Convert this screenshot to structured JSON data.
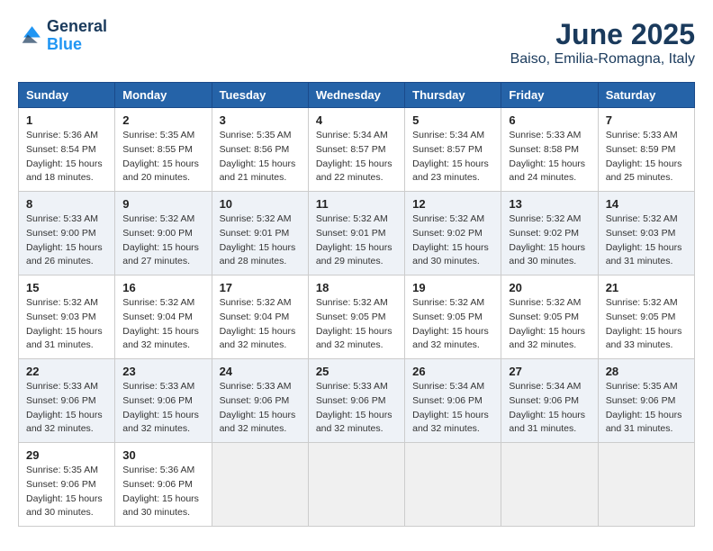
{
  "header": {
    "logo_line1": "General",
    "logo_line2": "Blue",
    "main_title": "June 2025",
    "subtitle": "Baiso, Emilia-Romagna, Italy"
  },
  "columns": [
    "Sunday",
    "Monday",
    "Tuesday",
    "Wednesday",
    "Thursday",
    "Friday",
    "Saturday"
  ],
  "weeks": [
    {
      "days": [
        {
          "num": "1",
          "info": "Sunrise: 5:36 AM\nSunset: 8:54 PM\nDaylight: 15 hours\nand 18 minutes."
        },
        {
          "num": "2",
          "info": "Sunrise: 5:35 AM\nSunset: 8:55 PM\nDaylight: 15 hours\nand 20 minutes."
        },
        {
          "num": "3",
          "info": "Sunrise: 5:35 AM\nSunset: 8:56 PM\nDaylight: 15 hours\nand 21 minutes."
        },
        {
          "num": "4",
          "info": "Sunrise: 5:34 AM\nSunset: 8:57 PM\nDaylight: 15 hours\nand 22 minutes."
        },
        {
          "num": "5",
          "info": "Sunrise: 5:34 AM\nSunset: 8:57 PM\nDaylight: 15 hours\nand 23 minutes."
        },
        {
          "num": "6",
          "info": "Sunrise: 5:33 AM\nSunset: 8:58 PM\nDaylight: 15 hours\nand 24 minutes."
        },
        {
          "num": "7",
          "info": "Sunrise: 5:33 AM\nSunset: 8:59 PM\nDaylight: 15 hours\nand 25 minutes."
        }
      ]
    },
    {
      "days": [
        {
          "num": "8",
          "info": "Sunrise: 5:33 AM\nSunset: 9:00 PM\nDaylight: 15 hours\nand 26 minutes."
        },
        {
          "num": "9",
          "info": "Sunrise: 5:32 AM\nSunset: 9:00 PM\nDaylight: 15 hours\nand 27 minutes."
        },
        {
          "num": "10",
          "info": "Sunrise: 5:32 AM\nSunset: 9:01 PM\nDaylight: 15 hours\nand 28 minutes."
        },
        {
          "num": "11",
          "info": "Sunrise: 5:32 AM\nSunset: 9:01 PM\nDaylight: 15 hours\nand 29 minutes."
        },
        {
          "num": "12",
          "info": "Sunrise: 5:32 AM\nSunset: 9:02 PM\nDaylight: 15 hours\nand 30 minutes."
        },
        {
          "num": "13",
          "info": "Sunrise: 5:32 AM\nSunset: 9:02 PM\nDaylight: 15 hours\nand 30 minutes."
        },
        {
          "num": "14",
          "info": "Sunrise: 5:32 AM\nSunset: 9:03 PM\nDaylight: 15 hours\nand 31 minutes."
        }
      ]
    },
    {
      "days": [
        {
          "num": "15",
          "info": "Sunrise: 5:32 AM\nSunset: 9:03 PM\nDaylight: 15 hours\nand 31 minutes."
        },
        {
          "num": "16",
          "info": "Sunrise: 5:32 AM\nSunset: 9:04 PM\nDaylight: 15 hours\nand 32 minutes."
        },
        {
          "num": "17",
          "info": "Sunrise: 5:32 AM\nSunset: 9:04 PM\nDaylight: 15 hours\nand 32 minutes."
        },
        {
          "num": "18",
          "info": "Sunrise: 5:32 AM\nSunset: 9:05 PM\nDaylight: 15 hours\nand 32 minutes."
        },
        {
          "num": "19",
          "info": "Sunrise: 5:32 AM\nSunset: 9:05 PM\nDaylight: 15 hours\nand 32 minutes."
        },
        {
          "num": "20",
          "info": "Sunrise: 5:32 AM\nSunset: 9:05 PM\nDaylight: 15 hours\nand 32 minutes."
        },
        {
          "num": "21",
          "info": "Sunrise: 5:32 AM\nSunset: 9:05 PM\nDaylight: 15 hours\nand 33 minutes."
        }
      ]
    },
    {
      "days": [
        {
          "num": "22",
          "info": "Sunrise: 5:33 AM\nSunset: 9:06 PM\nDaylight: 15 hours\nand 32 minutes."
        },
        {
          "num": "23",
          "info": "Sunrise: 5:33 AM\nSunset: 9:06 PM\nDaylight: 15 hours\nand 32 minutes."
        },
        {
          "num": "24",
          "info": "Sunrise: 5:33 AM\nSunset: 9:06 PM\nDaylight: 15 hours\nand 32 minutes."
        },
        {
          "num": "25",
          "info": "Sunrise: 5:33 AM\nSunset: 9:06 PM\nDaylight: 15 hours\nand 32 minutes."
        },
        {
          "num": "26",
          "info": "Sunrise: 5:34 AM\nSunset: 9:06 PM\nDaylight: 15 hours\nand 32 minutes."
        },
        {
          "num": "27",
          "info": "Sunrise: 5:34 AM\nSunset: 9:06 PM\nDaylight: 15 hours\nand 31 minutes."
        },
        {
          "num": "28",
          "info": "Sunrise: 5:35 AM\nSunset: 9:06 PM\nDaylight: 15 hours\nand 31 minutes."
        }
      ]
    },
    {
      "days": [
        {
          "num": "29",
          "info": "Sunrise: 5:35 AM\nSunset: 9:06 PM\nDaylight: 15 hours\nand 30 minutes."
        },
        {
          "num": "30",
          "info": "Sunrise: 5:36 AM\nSunset: 9:06 PM\nDaylight: 15 hours\nand 30 minutes."
        },
        {
          "num": "",
          "info": ""
        },
        {
          "num": "",
          "info": ""
        },
        {
          "num": "",
          "info": ""
        },
        {
          "num": "",
          "info": ""
        },
        {
          "num": "",
          "info": ""
        }
      ]
    }
  ]
}
